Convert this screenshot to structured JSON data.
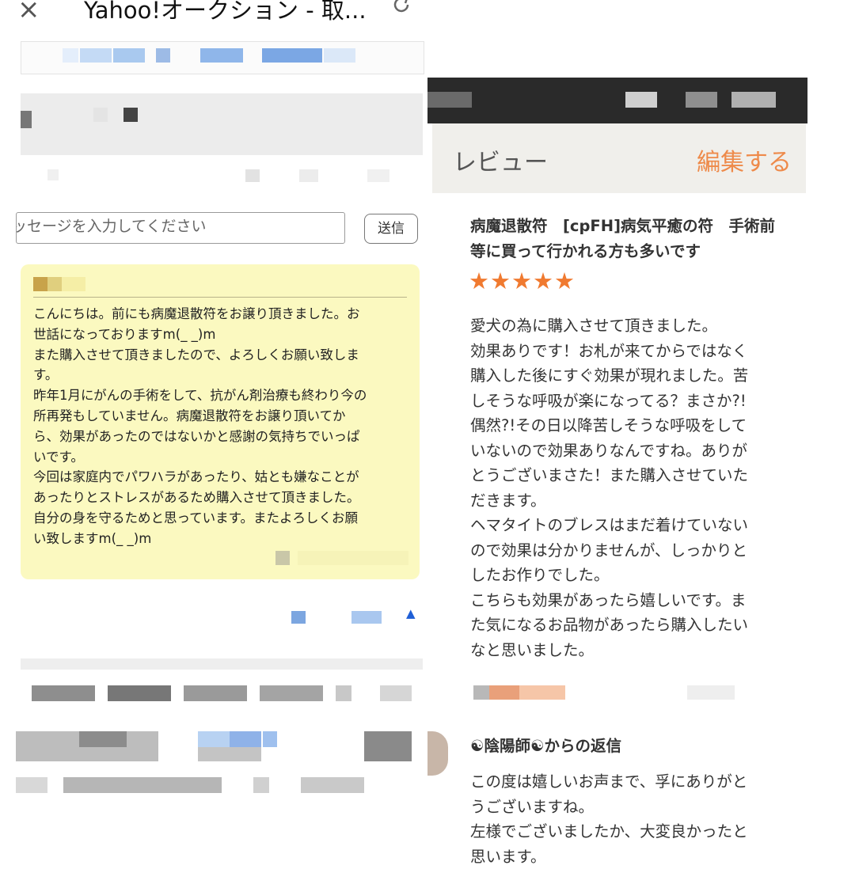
{
  "left_panel": {
    "close_icon": "×",
    "title": "Yahoo!オークション - 取...",
    "message_input": {
      "placeholder": "ッセージを入力してください"
    },
    "send_button": "送信",
    "message_bubble": {
      "text": "こんにちは。前にも病魔退散符をお譲り頂きました。お\n世話になっておりますm(_ _)m\nまた購入させて頂きましたので、よろしくお願い致しま\nす。\n昨年1月にがんの手術をして、抗がん剤治療も終わり今の\n所再発もしていません。病魔退散符をお譲り頂いてか\nら、効果があったのではないかと感謝の気持ちでいっぱ\nいです。\n今回は家庭内でパワハラがあったり、姑とも嫌なことが\nあったりとストレスがあるため購入させて頂きました。\n自分の身を守るためと思っています。またよろしくお願\nい致しますm(_ _)m"
    },
    "scroll_top_icon": "▲"
  },
  "right_panel": {
    "header": {
      "label": "レビュー",
      "edit": "編集する"
    },
    "review": {
      "title": "病魔退散符　[cpFH]病気平癒の符　手術前等に買って行かれる方も多いです",
      "stars": "★★★★★",
      "rating": 5,
      "body": "愛犬の為に購入させて頂きました。\n効果ありです！お札が来てからではなく\n購入した後にすぐ効果が現れました。苦\nしそうな呼吸が楽になってる？まさか?!\n偶然?!その日以降苦しそうな呼吸をして\nいないので効果ありなんですね。ありが\nとうございまさた！また購入させていた\nだきます。\nヘマタイトのブレスはまだ着けていない\nので効果は分かりませんが、しっかりと\nしたお作りでした。\nこちらも効果があったら嬉しいです。ま\nた気になるお品物があったら購入したい\nなと思いました。"
    },
    "reply": {
      "title": "☯陰陽師☯からの返信",
      "body": "この度は嬉しいお声まで、孚にありがと\nうございますね。\n左様でございましたか、大変良かったと\n思います。"
    }
  },
  "colors": {
    "accent": "#ee8a4a",
    "star": "#f07a30",
    "bubble": "#fbf9c0",
    "link_blue": "#1f5fd6"
  }
}
